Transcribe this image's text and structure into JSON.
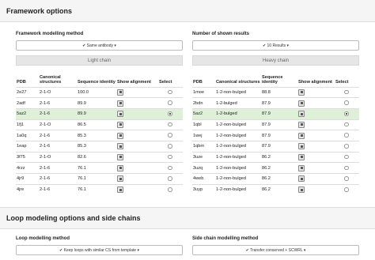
{
  "framework_title": "Framework options",
  "modelling_method": {
    "label": "Framework modelling method",
    "value": "✔ Same antibody ▾"
  },
  "shown_results": {
    "label": "Number of shown results",
    "value": "✔ 10 Results ▾"
  },
  "light_chain": {
    "title": "Light chain",
    "headers": [
      "PDB",
      "Canonical structures",
      "Sequence identity",
      "Show alignment",
      "Select"
    ],
    "rows": [
      {
        "pdb": "2e27",
        "cs": "2-1-O",
        "si": "100.0"
      },
      {
        "pdb": "2adf",
        "cs": "2-1-6",
        "si": "89.9"
      },
      {
        "pdb": "5az2",
        "cs": "2-1-6",
        "si": "89.9",
        "selected": true
      },
      {
        "pdb": "1fj1",
        "cs": "2-1-O",
        "si": "86.5"
      },
      {
        "pdb": "1a0q",
        "cs": "2-1-6",
        "si": "85.3"
      },
      {
        "pdb": "1eap",
        "cs": "2-1-6",
        "si": "85.3"
      },
      {
        "pdb": "3f75",
        "cs": "2-1-O",
        "si": "82.6"
      },
      {
        "pdb": "4rzz",
        "cs": "2-1-6",
        "si": "76.1"
      },
      {
        "pdb": "4jr9",
        "cs": "2-1-6",
        "si": "76.1"
      },
      {
        "pdb": "4jre",
        "cs": "2-1-6",
        "si": "76.1"
      }
    ]
  },
  "heavy_chain": {
    "title": "Heavy chain",
    "headers": [
      "PDB",
      "Canonical structures",
      "Sequence identity",
      "Show alignment",
      "Select"
    ],
    "rows": [
      {
        "pdb": "1moe",
        "cs": "1-2-non-bulged",
        "si": "88.8"
      },
      {
        "pdb": "2bdn",
        "cs": "1-2-bulged",
        "si": "87.9"
      },
      {
        "pdb": "5az2",
        "cs": "1-2-bulged",
        "si": "87.9",
        "selected": true
      },
      {
        "pdb": "1qbl",
        "cs": "1-2-non-bulged",
        "si": "87.9"
      },
      {
        "pdb": "1wej",
        "cs": "1-2-non-bulged",
        "si": "87.9"
      },
      {
        "pdb": "1qbm",
        "cs": "1-2-non-bulged",
        "si": "87.9"
      },
      {
        "pdb": "3uze",
        "cs": "1-2-non-bulged",
        "si": "86.2"
      },
      {
        "pdb": "3uzq",
        "cs": "1-2-non-bulged",
        "si": "86.2"
      },
      {
        "pdb": "4web",
        "cs": "1-2-non-bulged",
        "si": "86.2"
      },
      {
        "pdb": "3uyp",
        "cs": "1-2-non-bulged",
        "si": "86.2"
      }
    ]
  },
  "loop_title": "Loop modeling options and side chains",
  "loop_method": {
    "label": "Loop modelling method",
    "value": "✔ Keep loops with similar CS from template ▾"
  },
  "side_chain": {
    "label": "Side chain modelling method",
    "value": "✔ Transfer conserved + SCWRL ▾"
  },
  "icons": {
    "show_alignment": "alignment-view-icon",
    "select": "radio-icon"
  }
}
